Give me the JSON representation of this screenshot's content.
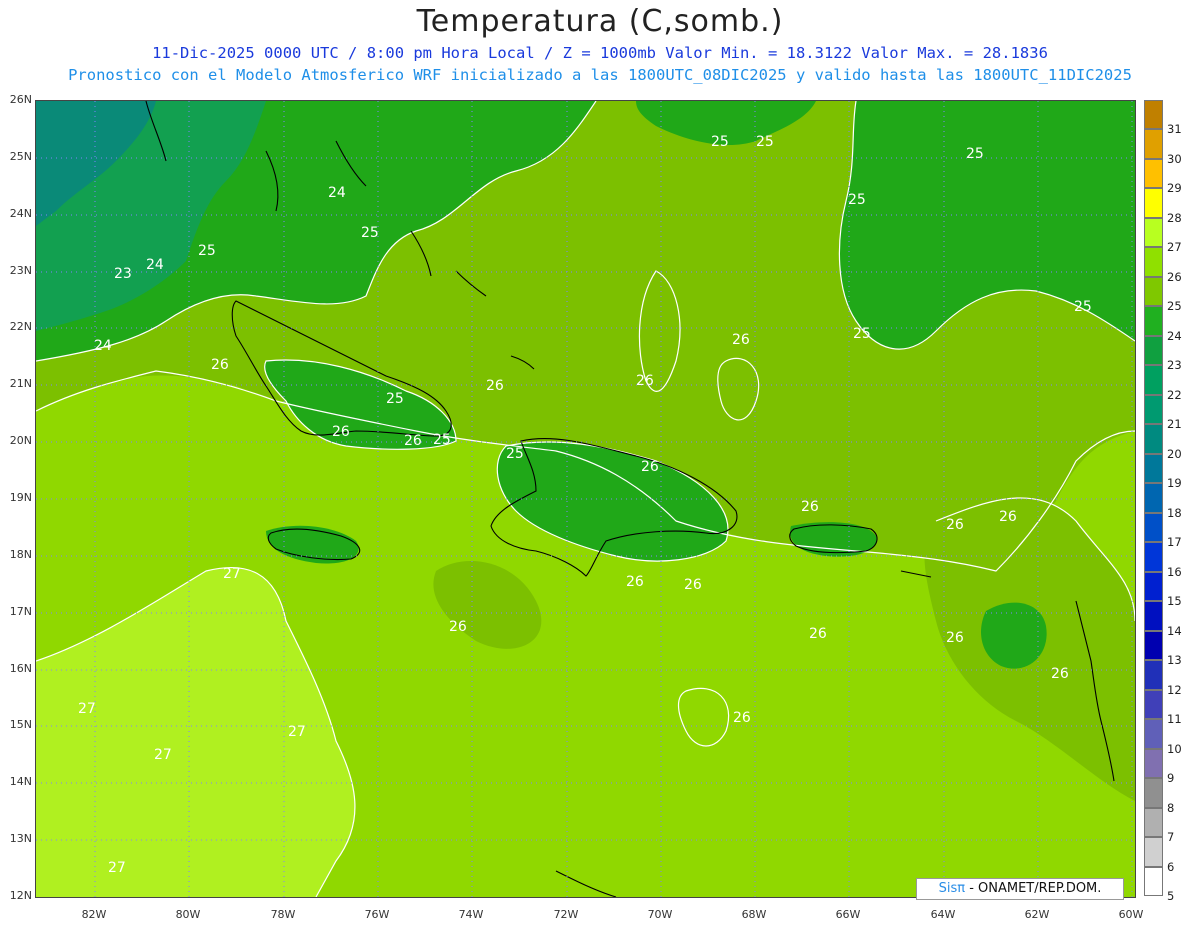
{
  "header": {
    "title": "Temperatura (C,somb.)",
    "subtitle_line1": "11-Dic-2025  0000 UTC / 8:00 pm Hora Local / Z = 1000mb   Valor Min. = 18.3122  Valor Max. = 28.1836",
    "subtitle_line2": "Pronostico con el Modelo Atmosferico WRF inicializado a las 1800UTC_08DIC2025 y valido hasta las  1800UTC_11DIC2025"
  },
  "map": {
    "lat_labels": [
      "26N",
      "25N",
      "24N",
      "23N",
      "22N",
      "21N",
      "20N",
      "19N",
      "18N",
      "17N",
      "16N",
      "15N",
      "14N",
      "13N",
      "12N"
    ],
    "lon_labels": [
      "82W",
      "80W",
      "78W",
      "76W",
      "74W",
      "72W",
      "70W",
      "68W",
      "66W",
      "64W",
      "62W",
      "60W"
    ],
    "contour_labels": [
      {
        "text": "25"
      },
      {
        "text": "25"
      },
      {
        "text": "25"
      },
      {
        "text": "25"
      },
      {
        "text": "25"
      },
      {
        "text": "25"
      },
      {
        "text": "24"
      },
      {
        "text": "24"
      },
      {
        "text": "24"
      },
      {
        "text": "23"
      },
      {
        "text": "25"
      },
      {
        "text": "25"
      },
      {
        "text": "26"
      },
      {
        "text": "26"
      },
      {
        "text": "26"
      },
      {
        "text": "26"
      },
      {
        "text": "26"
      },
      {
        "text": "25"
      },
      {
        "text": "25"
      },
      {
        "text": "25"
      },
      {
        "text": "26"
      },
      {
        "text": "26"
      },
      {
        "text": "26"
      },
      {
        "text": "26"
      },
      {
        "text": "26"
      },
      {
        "text": "26"
      },
      {
        "text": "26"
      },
      {
        "text": "26"
      },
      {
        "text": "26"
      },
      {
        "text": "26"
      },
      {
        "text": "27"
      },
      {
        "text": "27"
      },
      {
        "text": "27"
      },
      {
        "text": "27"
      },
      {
        "text": "27"
      },
      {
        "text": "26"
      },
      {
        "text": "26"
      }
    ]
  },
  "colorbar": {
    "levels": [
      "31",
      "30",
      "29",
      "28",
      "27",
      "26",
      "25",
      "24",
      "23",
      "22",
      "21",
      "20",
      "19",
      "18",
      "17",
      "16",
      "15",
      "14",
      "13",
      "12",
      "11",
      "10",
      "9",
      "8",
      "7",
      "6",
      "5"
    ],
    "colors": [
      "#c08000",
      "#e0a000",
      "#ffc000",
      "#ffff00",
      "#b8ff20",
      "#90e000",
      "#7fc800",
      "#20b020",
      "#10a040",
      "#00a060",
      "#009a70",
      "#008a80",
      "#00789a",
      "#0066b0",
      "#0050c8",
      "#0036d8",
      "#0020d0",
      "#0010c0",
      "#0000b0",
      "#2030b8",
      "#4040b8",
      "#6060b8",
      "#8070b0",
      "#909090",
      "#b0b0b0",
      "#d0d0d0",
      "#ffffff"
    ]
  },
  "credit": {
    "brand": "Sisπ",
    "text": " - ONAMET/REP.DOM."
  }
}
